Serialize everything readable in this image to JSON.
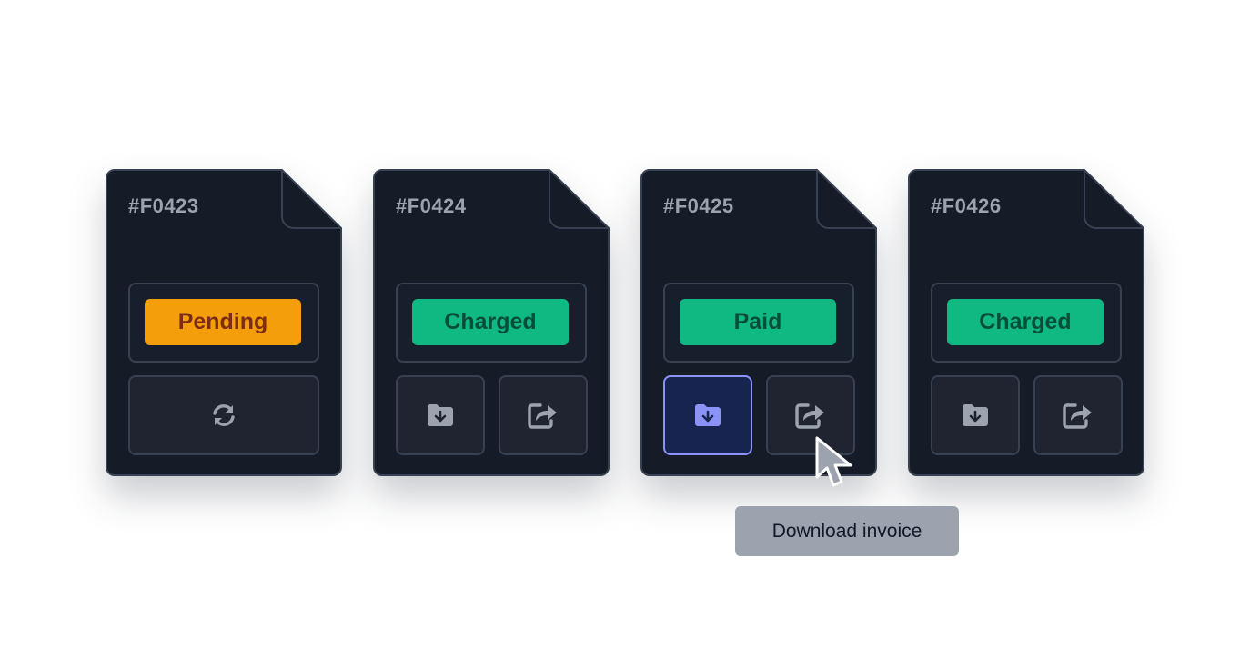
{
  "invoices": [
    {
      "id": "#F0423",
      "status": "Pending",
      "status_color": "#f59e0b",
      "actions": [
        "refresh-icon"
      ]
    },
    {
      "id": "#F0424",
      "status": "Charged",
      "status_color": "#10b981",
      "actions": [
        "download-folder-icon",
        "share-icon"
      ]
    },
    {
      "id": "#F0425",
      "status": "Paid",
      "status_color": "#10b981",
      "actions": [
        "download-folder-icon",
        "share-icon"
      ],
      "active_action": "download-folder-icon"
    },
    {
      "id": "#F0426",
      "status": "Charged",
      "status_color": "#10b981",
      "actions": [
        "download-folder-icon",
        "share-icon"
      ]
    }
  ],
  "tooltip": {
    "text": "Download invoice"
  },
  "colors": {
    "card_bg": "#151b27",
    "card_border": "#374151",
    "accent": "#8b93f8"
  }
}
